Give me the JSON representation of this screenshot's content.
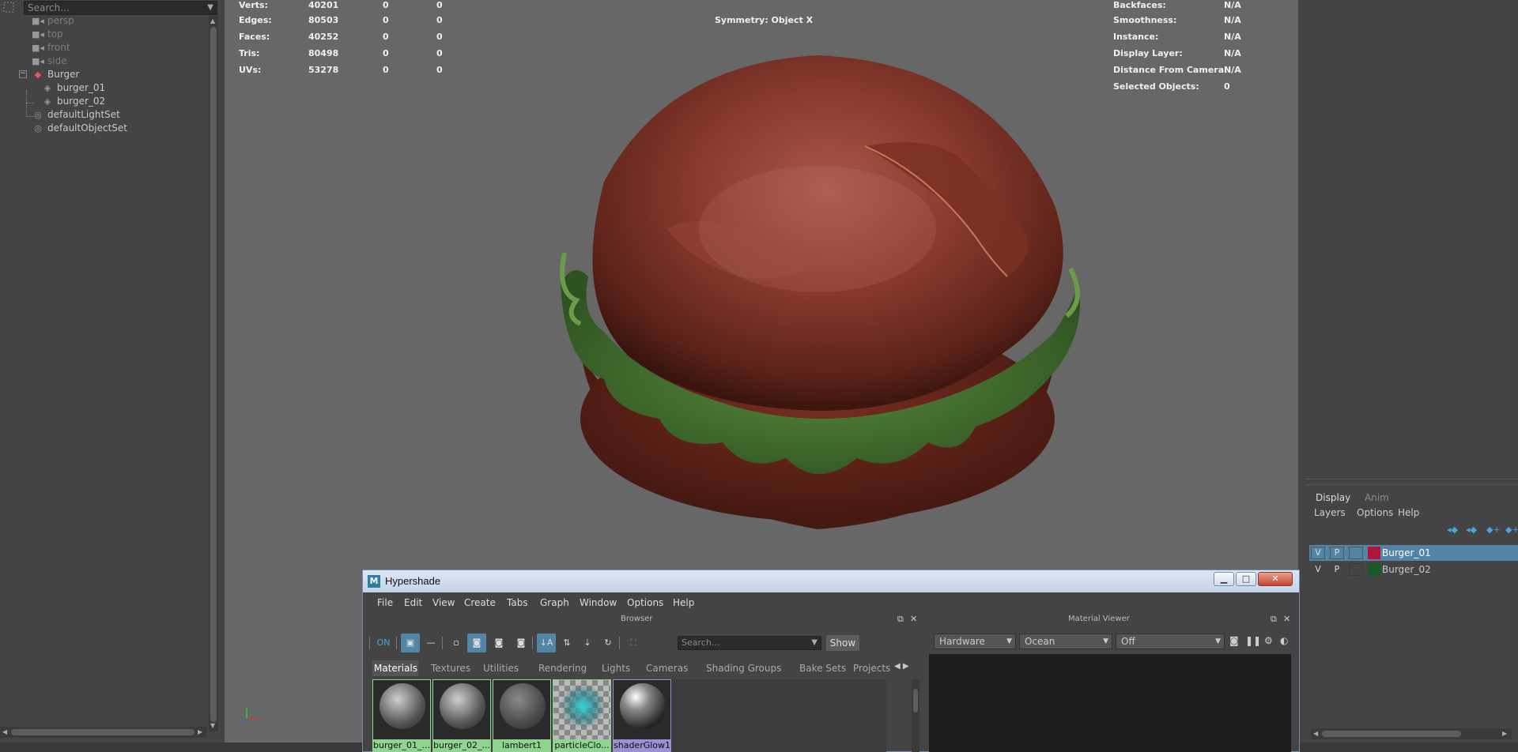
{
  "outliner": {
    "search_placeholder": "Search...",
    "items": [
      {
        "label": "persp",
        "icon": "camera-icon"
      },
      {
        "label": "top",
        "icon": "camera-icon"
      },
      {
        "label": "front",
        "icon": "camera-icon"
      },
      {
        "label": "side",
        "icon": "camera-icon"
      },
      {
        "label": "Burger",
        "icon": "group-icon"
      },
      {
        "label": "burger_01",
        "icon": "mesh-icon"
      },
      {
        "label": "burger_02",
        "icon": "mesh-icon"
      },
      {
        "label": "defaultLightSet",
        "icon": "set-icon"
      },
      {
        "label": "defaultObjectSet",
        "icon": "set-icon"
      }
    ]
  },
  "viewport": {
    "hud_left": {
      "labels": [
        "Verts:",
        "Edges:",
        "Faces:",
        "Tris:",
        "UVs:"
      ],
      "col1": [
        "40201",
        "80503",
        "40252",
        "80498",
        "53278"
      ],
      "col2": [
        "0",
        "0",
        "0",
        "0",
        "0"
      ],
      "col3": [
        "0",
        "0",
        "0",
        "0",
        "0"
      ]
    },
    "symmetry": "Symmetry: Object X",
    "hud_right": {
      "labels": [
        "Backfaces:",
        "Smoothness:",
        "Instance:",
        "Display Layer:",
        "Distance From Camera:",
        "Selected Objects:"
      ],
      "values": [
        "N/A",
        "N/A",
        "N/A",
        "N/A",
        "N/A",
        "0"
      ]
    }
  },
  "layer_editor": {
    "tabs": [
      "Display",
      "Anim"
    ],
    "menus": [
      "Layers",
      "Options",
      "Help"
    ],
    "layers": [
      {
        "v": "V",
        "p": "P",
        "name": "Burger_01",
        "color": "#b0143a",
        "selected": true
      },
      {
        "v": "V",
        "p": "P",
        "name": "Burger_02",
        "color": "#1a5a2a",
        "selected": false
      }
    ]
  },
  "hypershade": {
    "title": "Hypershade",
    "menus": [
      "File",
      "Edit",
      "View",
      "Create",
      "Tabs",
      "Graph",
      "Window",
      "Options",
      "Help"
    ],
    "browser": {
      "title": "Browser",
      "search_placeholder": "Search...",
      "show_label": "Show",
      "tabs": [
        "Materials",
        "Textures",
        "Utilities",
        "Rendering",
        "Lights",
        "Cameras",
        "Shading Groups",
        "Bake Sets",
        "Projects"
      ],
      "swatches": [
        {
          "label": "burger_01_...",
          "color": "#8fd48f"
        },
        {
          "label": "burger_02_...",
          "color": "#8fd48f"
        },
        {
          "label": "lambert1",
          "color": "#8fd48f"
        },
        {
          "label": "particleClo...",
          "color": "#8fd48f"
        },
        {
          "label": "shaderGlow1",
          "color": "#9b8fd6"
        }
      ]
    },
    "material_viewer": {
      "title": "Material Viewer",
      "renderer": "Hardware",
      "shape": "Ocean",
      "env": "Off"
    }
  },
  "colors": {
    "accent": "#5285a6",
    "viewport_bg": "#676767",
    "panel_bg": "#444444"
  }
}
